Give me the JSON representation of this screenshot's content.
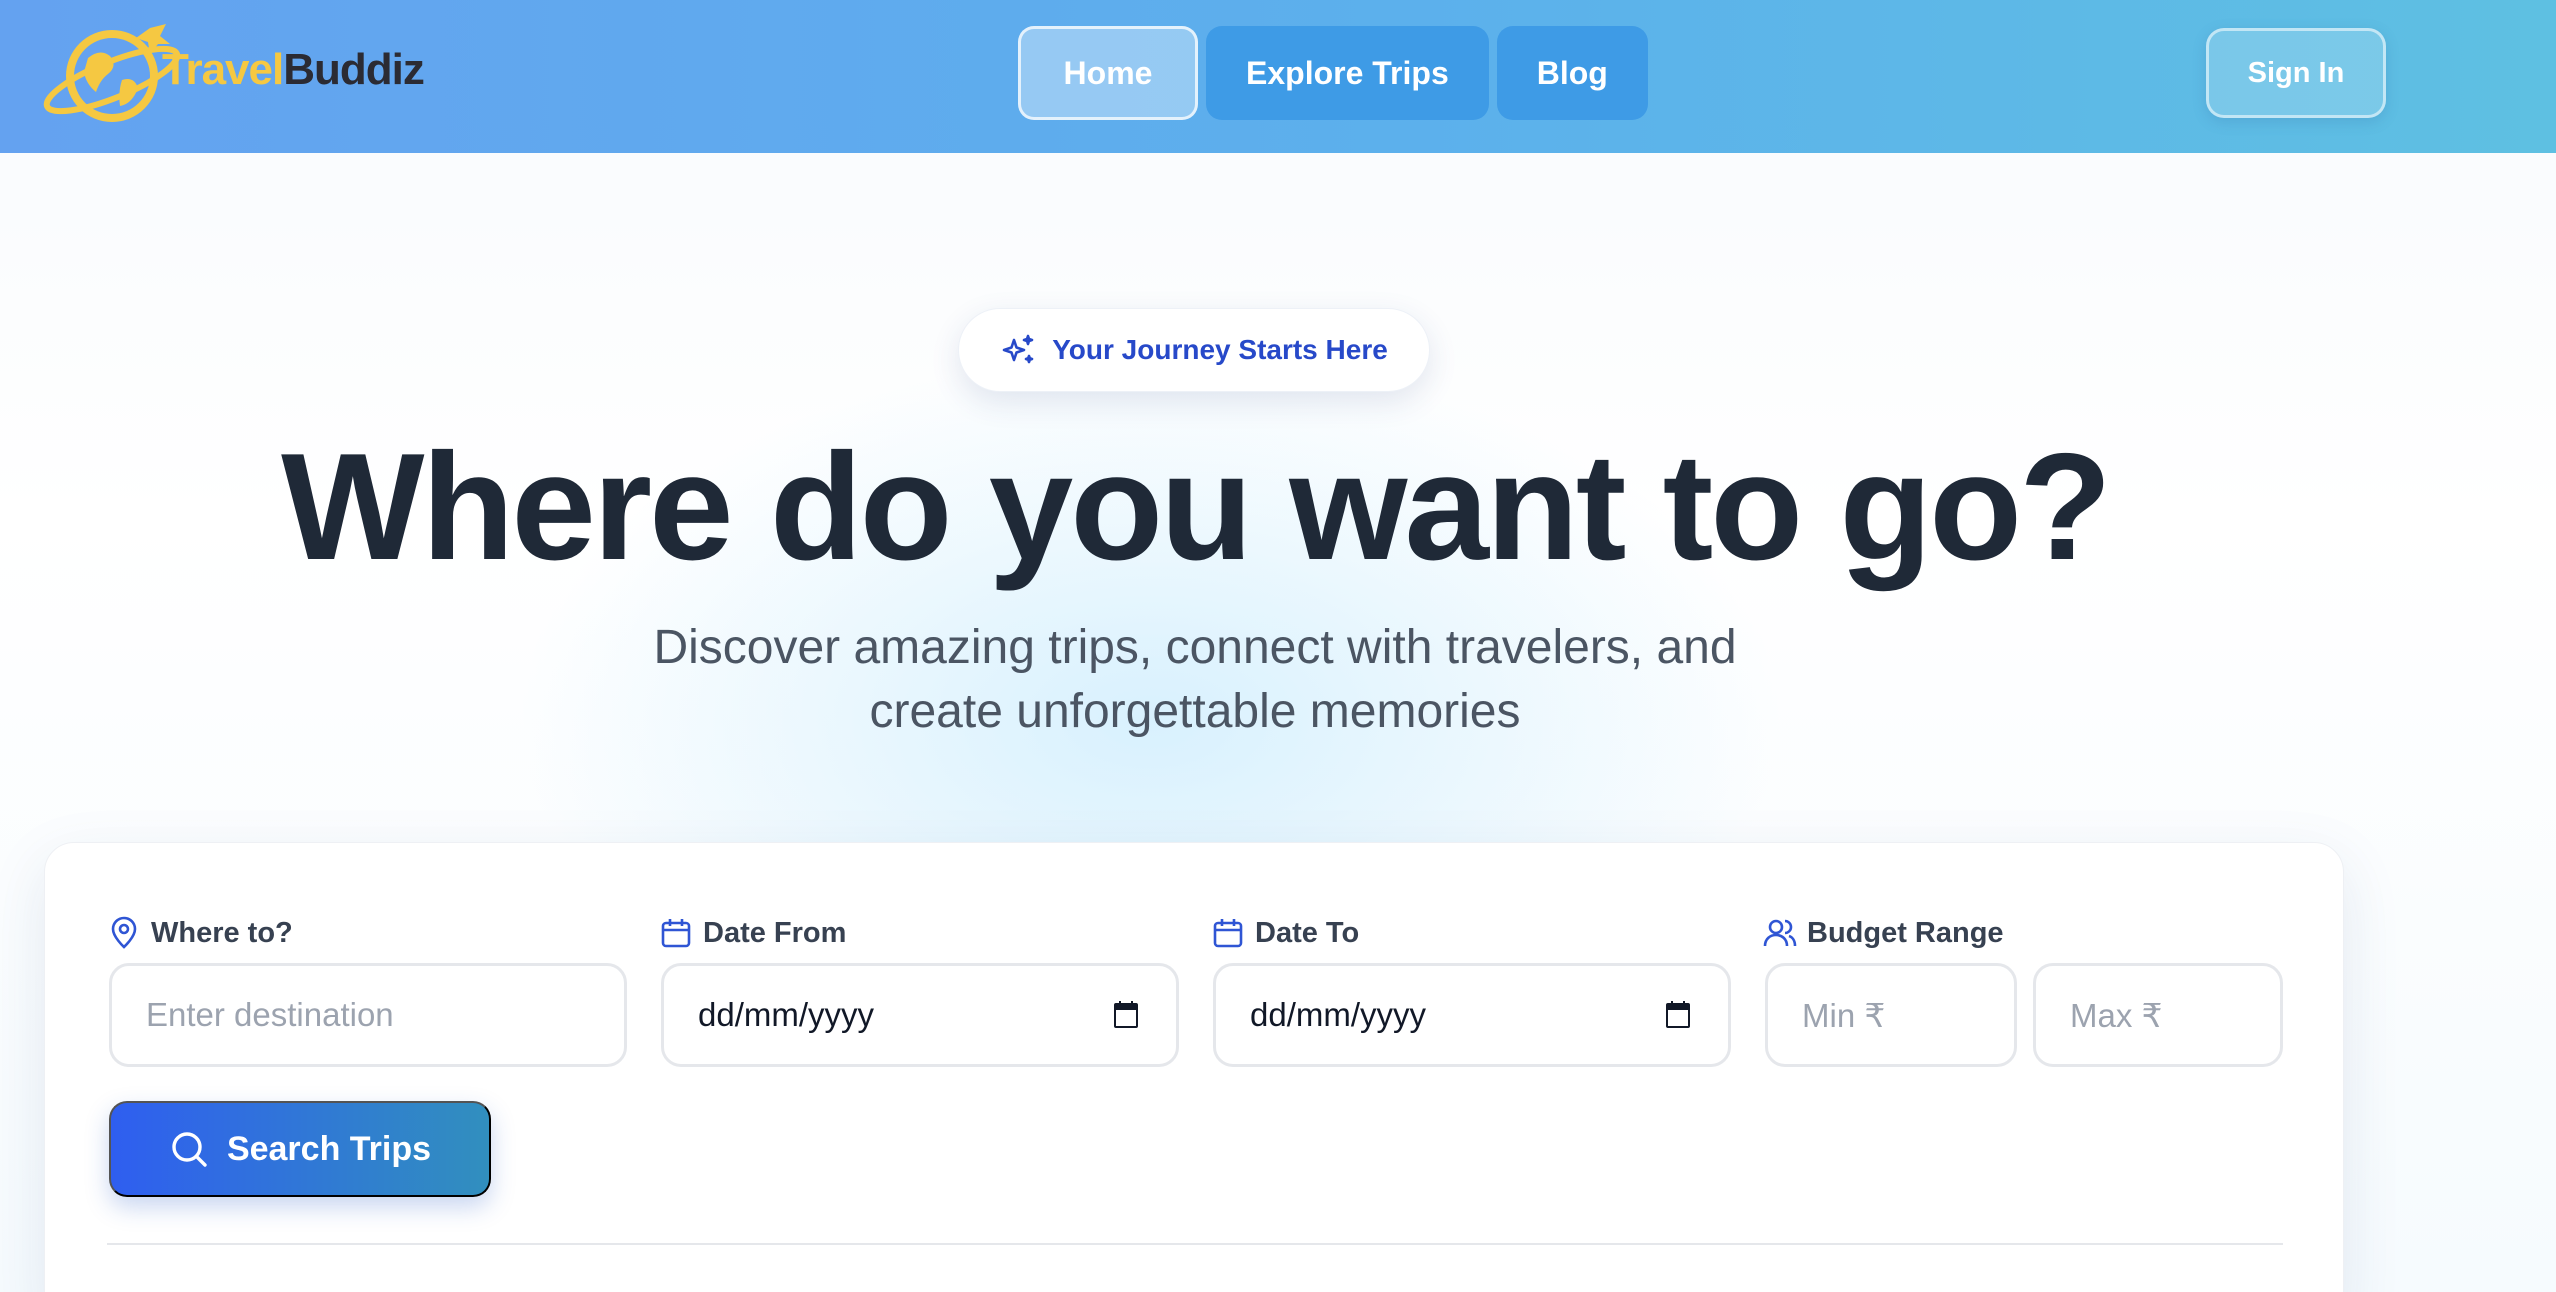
{
  "brand": {
    "name_part1": "Travel",
    "name_part2": "Buddiz"
  },
  "nav": {
    "items": [
      "Home",
      "Explore Trips",
      "Blog"
    ],
    "sign_in": "Sign In"
  },
  "hero": {
    "badge": "Your Journey Starts Here",
    "title": "Where do you want to go?",
    "subtitle_line1": "Discover amazing trips, connect with travelers, and",
    "subtitle_line2": "create unforgettable memories"
  },
  "search": {
    "destination_label": "Where to?",
    "destination_placeholder": "Enter destination",
    "date_from_label": "Date From",
    "date_from_value": "dd/mm/yyyy",
    "date_to_label": "Date To",
    "date_to_value": "dd/mm/yyyy",
    "budget_label": "Budget Range",
    "budget_min_placeholder": "Min ₹",
    "budget_max_placeholder": "Max ₹",
    "button": "Search Trips"
  },
  "colors": {
    "accent": "#2749c9",
    "title": "#1f2937",
    "logo_yellow": "#f5c842",
    "nav_button": "#3e9be6"
  },
  "icons": [
    "globe-plane-logo",
    "sparkles-icon",
    "map-pin-icon",
    "calendar-icon",
    "users-icon",
    "search-icon"
  ]
}
